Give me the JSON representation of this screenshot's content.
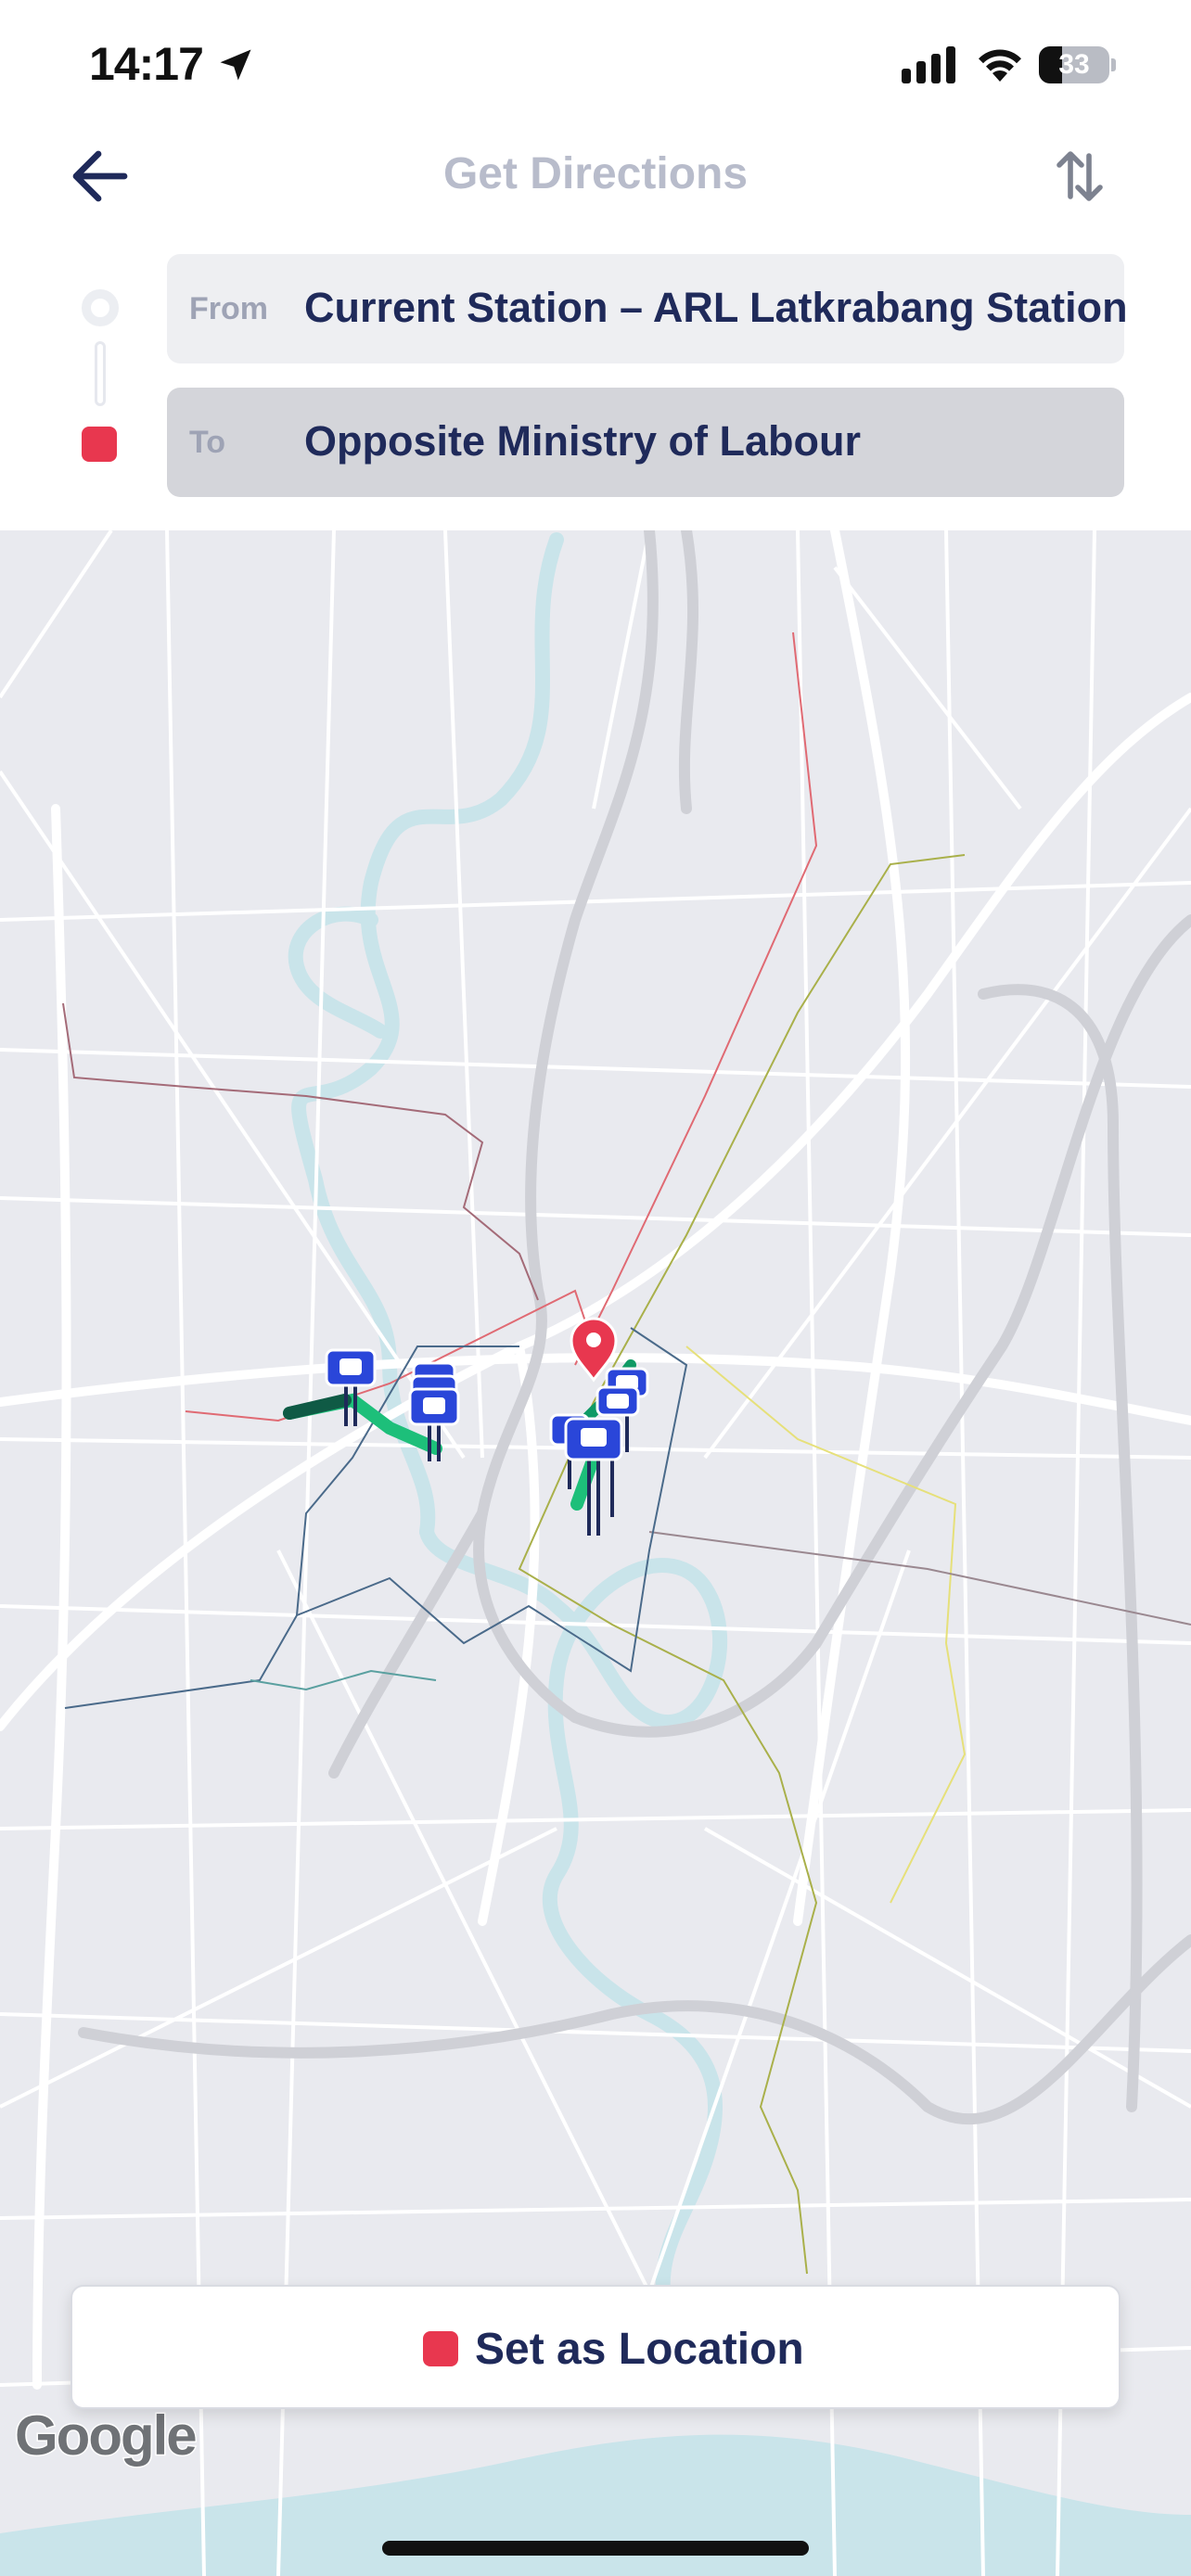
{
  "status_bar": {
    "time": "14:17",
    "battery_text": "33",
    "battery_level_percent": 33,
    "icons": [
      "location-arrow-icon",
      "cellular-signal-icon",
      "wifi-icon",
      "battery-icon"
    ]
  },
  "header": {
    "title": "Get Directions",
    "back_icon": "arrow-left-icon",
    "swap_icon": "swap-vertical-icon"
  },
  "route": {
    "from_label": "From",
    "from_value": "Current Station – ARL Latkrabang Station",
    "to_label": "To",
    "to_value": "Opposite Ministry of Labour"
  },
  "map": {
    "attribution": "Google",
    "markers": [
      "bus-stop-icon",
      "bus-stop-icon",
      "bus-stop-icon",
      "bus-stop-icon",
      "location-pin-icon"
    ]
  },
  "action": {
    "set_location_label": "Set as Location"
  },
  "colors": {
    "accent": "#e8374f",
    "text_primary": "#1f2a5a",
    "title_muted": "#b8bccb",
    "route_green": "#1dbf7a",
    "bus_marker": "#2a46d9"
  }
}
